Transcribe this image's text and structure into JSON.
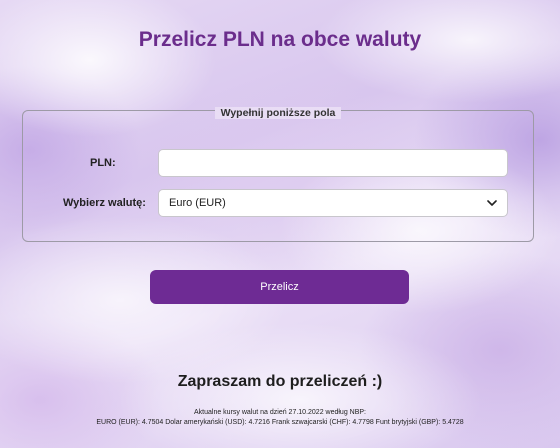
{
  "page": {
    "title": "Przelicz PLN na obce waluty"
  },
  "form": {
    "legend": "Wypełnij poniższe pola",
    "pln_label": "PLN:",
    "pln_value": "",
    "currency_label": "Wybierz walutę:",
    "currency_selected": "Euro (EUR)",
    "submit_label": "Przelicz"
  },
  "footer": {
    "subtitle": "Zapraszam do przeliczeń :)",
    "rates_title": "Aktualne kursy walut na dzień 27.10.2022 według NBP:",
    "rates_line": "EURO (EUR): 4.7504 Dolar amerykański (USD): 4.7216 Frank szwajcarski (CHF): 4.7798 Funt brytyjski (GBP): 5.4728"
  },
  "icons": {
    "select_arrow": "chevron-down-icon"
  },
  "colors": {
    "accent": "#6e2b94",
    "title": "#6b2d8c"
  }
}
